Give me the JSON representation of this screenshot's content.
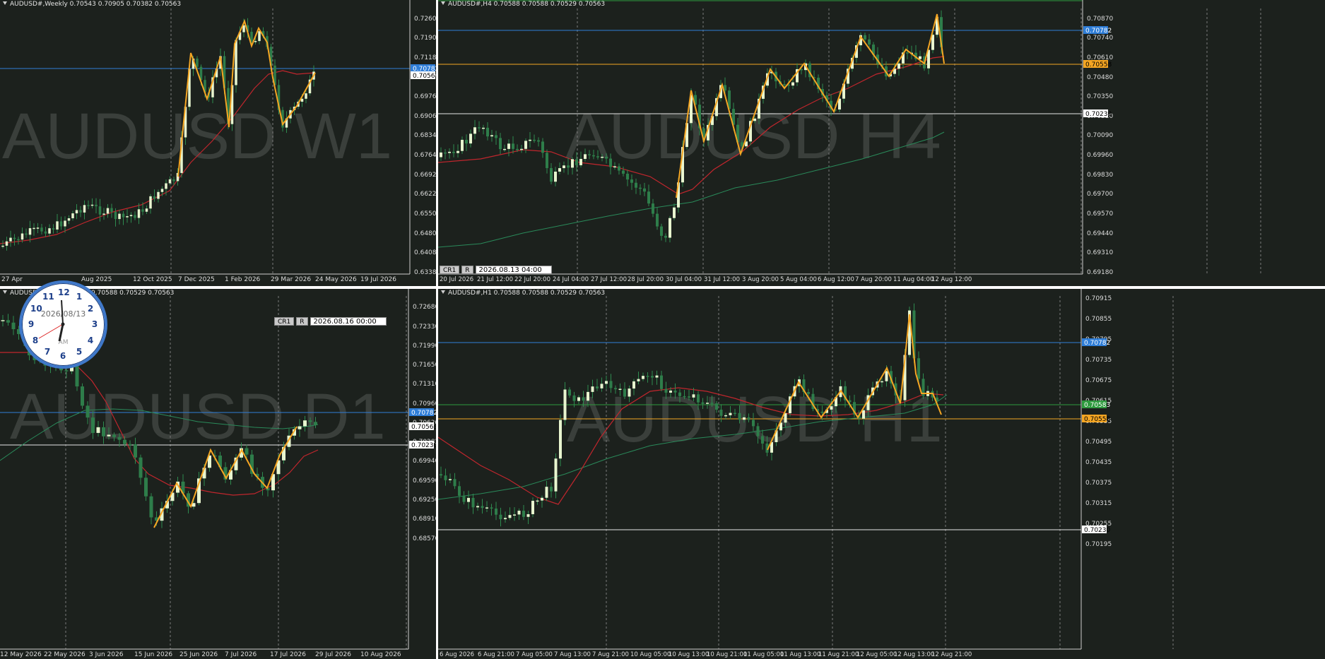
{
  "colors": {
    "background": "#1c211d",
    "bull_candle": "#e8f5cf",
    "bear_candle": "#2e7d4a",
    "wick": "#2e8b4f",
    "zigzag": "#f5a623",
    "ma_fast": "#c0262d",
    "ma_slow": "#2a8a5a",
    "line_blue": "#2f7ed8",
    "line_orange": "#f5a623",
    "line_white": "#e6e6e6",
    "line_green": "#2e9a3e",
    "watermark": "#3a3f3b"
  },
  "panels": [
    {
      "id": "w1",
      "header": "AUDUSD#,Weekly  0.70543 0.70905 0.70382 0.70563",
      "watermark": "AUDUSD W1",
      "yticks": [
        "0.72600",
        "0.71900",
        "0.71180",
        "0.70470",
        "0.69760",
        "0.69060",
        "0.68340",
        "0.67640",
        "0.66920",
        "0.66220",
        "0.65500",
        "0.64800",
        "0.64080",
        "0.63380"
      ],
      "xticks": [
        "27 Apr",
        "Aug 2025",
        "12 Oct 2025",
        "7 Dec 2025",
        "1 Feb 2026",
        "29 Mar 2026",
        "24 May 2026",
        "19 Jul 2026"
      ],
      "price_labels": [
        {
          "text": "0.70782",
          "kind": "blue"
        },
        {
          "text": "0.70563",
          "kind": "white"
        }
      ],
      "buttons": [
        "CR1",
        "R"
      ],
      "datetime": "2026.08.16 00:00",
      "chart_data": {
        "type": "candlestick",
        "ylim": [
          0.6338,
          0.7295
        ],
        "trend": "up",
        "last_close": 0.70563
      }
    },
    {
      "id": "h4",
      "header": "AUDUSD#,H4  0.70588 0.70588 0.70529 0.70563",
      "watermark": "AUDUSD H4",
      "yticks": [
        "0.70870",
        "0.70740",
        "0.70610",
        "0.70480",
        "0.70350",
        "0.70220",
        "0.70090",
        "0.69960",
        "0.69830",
        "0.69700",
        "0.69570",
        "0.69440",
        "0.69310",
        "0.69180"
      ],
      "xticks": [
        "20 Jul 2026",
        "21 Jul 12:00",
        "22 Jul 20:00",
        "24 Jul 04:00",
        "27 Jul 12:00",
        "28 Jul 20:00",
        "30 Jul 04:00",
        "31 Jul 12:00",
        "3 Aug 20:00",
        "5 Aug 04:00",
        "6 Aug 12:00",
        "7 Aug 20:00",
        "11 Aug 04:00",
        "12 Aug 12:00"
      ],
      "price_labels": [
        {
          "text": "0.70782",
          "kind": "blue"
        },
        {
          "text": "0.70558",
          "kind": "orange"
        },
        {
          "text": "0.70230",
          "kind": "white"
        }
      ],
      "buttons": [
        "CR1",
        "R"
      ],
      "datetime": "2026.08.13 04:00",
      "chart_data": {
        "type": "candlestick",
        "ylim": [
          0.6918,
          0.7093
        ],
        "trend": "up",
        "last_close": 0.70563
      }
    },
    {
      "id": "d1",
      "header": "AUDUSD#,Daily  0.70588 0.70588 0.70529 0.70563",
      "watermark": "AUDUSD D1",
      "yticks": [
        "0.72680",
        "0.72330",
        "0.71990",
        "0.71650",
        "0.71310",
        "0.70960",
        "0.70620",
        "0.70282",
        "0.69940",
        "0.69590",
        "0.69250",
        "0.68910",
        "0.68570"
      ],
      "xticks": [
        "12 May 2026",
        "22 May 2026",
        "3 Jun 2026",
        "15 Jun 2026",
        "25 Jun 2026",
        "7 Jul 2026",
        "17 Jul 2026",
        "29 Jul 2026",
        "10 Aug 2026"
      ],
      "price_labels": [
        {
          "text": "0.70782",
          "kind": "blue"
        },
        {
          "text": "0.70563",
          "kind": "white"
        },
        {
          "text": "0.70230",
          "kind": "white"
        }
      ],
      "chart_data": {
        "type": "candlestick",
        "ylim": [
          0.6857,
          0.7282
        ],
        "trend": "down-then-up",
        "last_close": 0.70563
      }
    },
    {
      "id": "h1",
      "header": "AUDUSD#,H1  0.70588 0.70588 0.70529 0.70563",
      "watermark": "AUDUSD H1",
      "yticks": [
        "0.70915",
        "0.70855",
        "0.70795",
        "0.70735",
        "0.70675",
        "0.70615",
        "0.70555",
        "0.70495",
        "0.70435",
        "0.70375",
        "0.70315",
        "0.70255",
        "0.70195"
      ],
      "xticks": [
        "6 Aug 2026",
        "6 Aug 21:00",
        "7 Aug 05:00",
        "7 Aug 13:00",
        "7 Aug 21:00",
        "10 Aug 05:00",
        "10 Aug 13:00",
        "10 Aug 21:00",
        "11 Aug 05:00",
        "11 Aug 13:00",
        "11 Aug 21:00",
        "12 Aug 05:00",
        "12 Aug 13:00",
        "12 Aug 21:00"
      ],
      "price_labels": [
        {
          "text": "0.70782",
          "kind": "blue"
        },
        {
          "text": "0.70583",
          "kind": "green"
        },
        {
          "text": "0.70558",
          "kind": "orange"
        },
        {
          "text": "0.70230",
          "kind": "white"
        }
      ],
      "chart_data": {
        "type": "candlestick",
        "ylim": [
          0.7019,
          0.7093
        ],
        "trend": "up",
        "last_close": 0.70563
      }
    }
  ],
  "clock": {
    "date": "2026/08/13",
    "ampm": "AM",
    "numbers": [
      "12",
      "1",
      "2",
      "3",
      "4",
      "5",
      "6",
      "7",
      "8",
      "9",
      "10",
      "11"
    ]
  }
}
